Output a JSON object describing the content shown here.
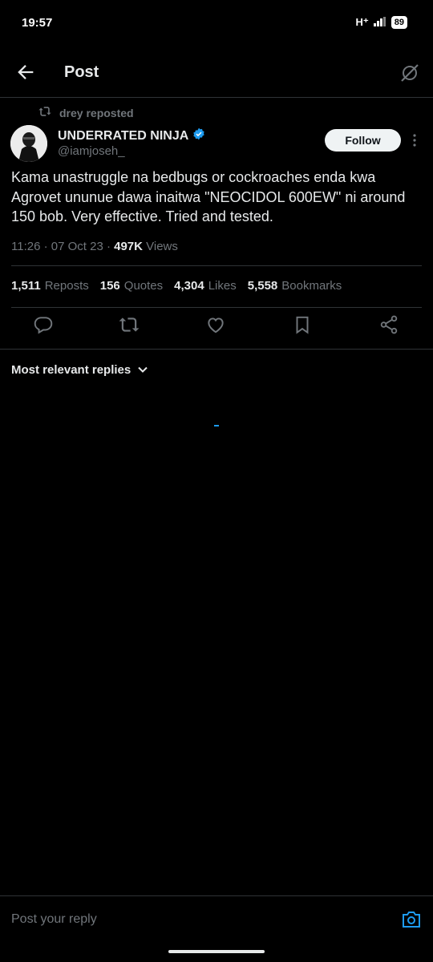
{
  "status_bar": {
    "time": "19:57",
    "network": "H⁺",
    "battery": "89"
  },
  "header": {
    "title": "Post"
  },
  "repost": {
    "text": "drey reposted"
  },
  "author": {
    "name": "UNDERRATED NINJA",
    "handle": "@iamjoseh_",
    "verified": true
  },
  "follow_label": "Follow",
  "post": {
    "text": "Kama unastruggle na bedbugs or cockroaches enda kwa Agrovet ununue dawa inaitwa \"NEOCIDOL 600EW\" ni around 150 bob. Very effective. Tried and tested.",
    "time": "11:26 · 07 Oct 23 · ",
    "views_count": "497K",
    "views_label": " Views"
  },
  "stats": [
    {
      "count": "1,511",
      "label": "Reposts"
    },
    {
      "count": "156",
      "label": "Quotes"
    },
    {
      "count": "4,304",
      "label": "Likes"
    },
    {
      "count": "5,558",
      "label": "Bookmarks"
    }
  ],
  "replies_sort": "Most relevant replies",
  "reply_placeholder": "Post your reply",
  "colors": {
    "accent": "#1d9bf0",
    "background": "#000000",
    "muted": "#71767b"
  }
}
